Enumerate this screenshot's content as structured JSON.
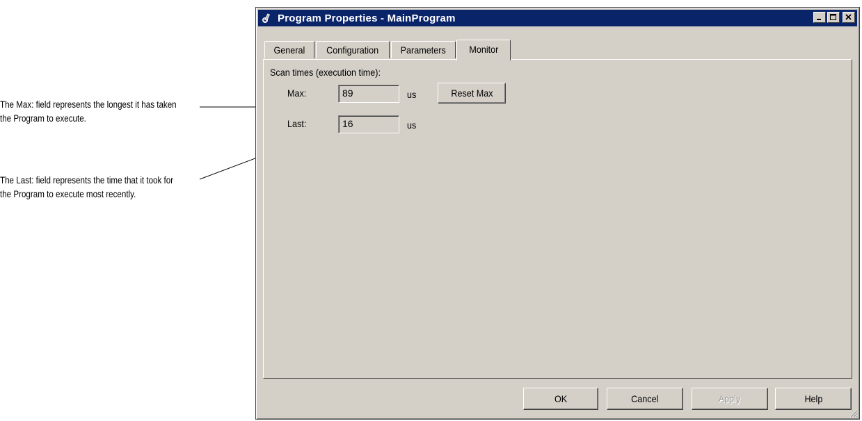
{
  "annotations": {
    "max_note": "The Max: field represents the longest it has taken the Program to execute.",
    "last_note": "The Last: field represents the time that it took for the Program to execute most recently."
  },
  "window": {
    "title": "Program Properties - MainProgram",
    "icon": "program-properties-icon"
  },
  "tabs": [
    {
      "label": "General",
      "active": false
    },
    {
      "label": "Configuration",
      "active": false
    },
    {
      "label": "Parameters",
      "active": false
    },
    {
      "label": "Monitor",
      "active": true
    }
  ],
  "monitor": {
    "section_label": "Scan times (execution time):",
    "max_label": "Max:",
    "max_value": "89",
    "max_unit": "us",
    "last_label": "Last:",
    "last_value": "16",
    "last_unit": "us",
    "reset_label": "Reset Max"
  },
  "footer": {
    "ok_label": "OK",
    "cancel_label": "Cancel",
    "apply_label": "Apply",
    "help_label": "Help"
  }
}
